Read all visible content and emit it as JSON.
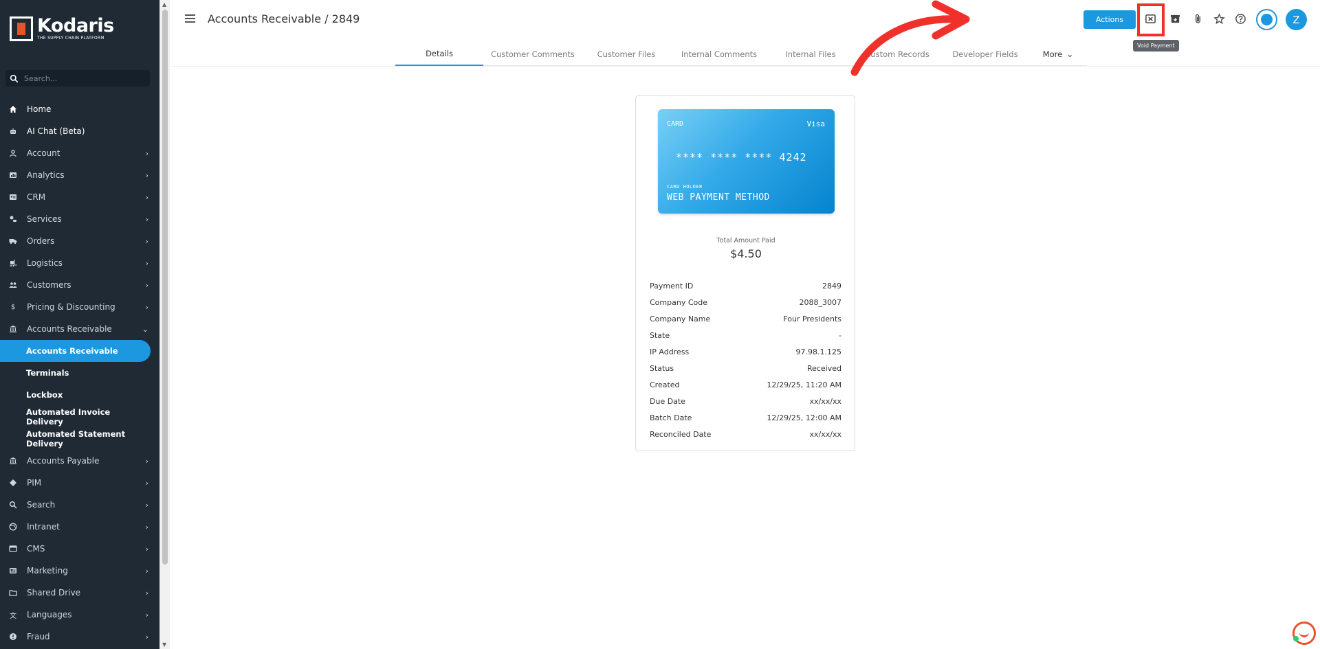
{
  "sidebar": {
    "logo_name": "Kodaris",
    "logo_tagline": "THE SUPPLY CHAIN PLATFORM",
    "search_placeholder": "Search...",
    "items": [
      {
        "label": "Home",
        "icon": "home-icon"
      },
      {
        "label": "AI Chat (Beta)",
        "icon": "robot-icon"
      },
      {
        "label": "Account",
        "icon": "user-icon"
      },
      {
        "label": "Analytics",
        "icon": "chart-icon"
      },
      {
        "label": "CRM",
        "icon": "contact-card-icon"
      },
      {
        "label": "Services",
        "icon": "services-icon"
      },
      {
        "label": "Orders",
        "icon": "truck-icon"
      },
      {
        "label": "Logistics",
        "icon": "forklift-icon"
      },
      {
        "label": "Customers",
        "icon": "people-icon"
      },
      {
        "label": "Pricing & Discounting",
        "icon": "dollar-icon"
      },
      {
        "label": "Accounts Receivable",
        "icon": "bank-icon"
      }
    ],
    "sub_items": [
      {
        "label": "Accounts Receivable"
      },
      {
        "label": "Terminals"
      },
      {
        "label": "Lockbox"
      },
      {
        "label": "Automated Invoice Delivery"
      },
      {
        "label": "Automated Statement Delivery"
      }
    ],
    "items_after": [
      {
        "label": "Accounts Payable",
        "icon": "bank-icon"
      },
      {
        "label": "PIM",
        "icon": "tag-icon"
      },
      {
        "label": "Search",
        "icon": "search-icon"
      },
      {
        "label": "Intranet",
        "icon": "globe-icon"
      },
      {
        "label": "CMS",
        "icon": "cms-icon"
      },
      {
        "label": "Marketing",
        "icon": "newspaper-icon"
      },
      {
        "label": "Shared Drive",
        "icon": "folder-icon"
      },
      {
        "label": "Languages",
        "icon": "translate-icon"
      },
      {
        "label": "Fraud",
        "icon": "alert-icon"
      }
    ]
  },
  "header": {
    "title": "Accounts Receivable / 2849",
    "actions_label": "Actions",
    "tooltip": "Void Payment",
    "avatar_initial": "Z"
  },
  "tabs": [
    {
      "label": "Details"
    },
    {
      "label": "Customer Comments"
    },
    {
      "label": "Customer Files"
    },
    {
      "label": "Internal Comments"
    },
    {
      "label": "Internal Files"
    },
    {
      "label": "Custom Records"
    },
    {
      "label": "Developer Fields"
    },
    {
      "label": "More"
    }
  ],
  "card": {
    "type": "CARD",
    "brand": "Visa",
    "number": "**** **** **** 4242",
    "holder_label": "CARD HOLDER",
    "holder": "WEB PAYMENT METHOD"
  },
  "amount": {
    "label": "Total Amount Paid",
    "value": "$4.50"
  },
  "details": [
    {
      "label": "Payment ID",
      "value": "2849"
    },
    {
      "label": "Company Code",
      "value": "2088_3007"
    },
    {
      "label": "Company Name",
      "value": "Four Presidents"
    },
    {
      "label": "State",
      "value": "-"
    },
    {
      "label": "IP Address",
      "value": "97.98.1.125"
    },
    {
      "label": "Status",
      "value": "Received"
    },
    {
      "label": "Created",
      "value": "12/29/25, 11:20 AM"
    },
    {
      "label": "Due Date",
      "value": "xx/xx/xx"
    },
    {
      "label": "Batch Date",
      "value": "12/29/25, 12:00 AM"
    },
    {
      "label": "Reconciled Date",
      "value": "xx/xx/xx"
    }
  ],
  "colors": {
    "accent": "#1b98e0",
    "sidebar_bg": "#1f2a35",
    "highlight_red": "#f0302a",
    "brand_orange": "#e8532b"
  }
}
